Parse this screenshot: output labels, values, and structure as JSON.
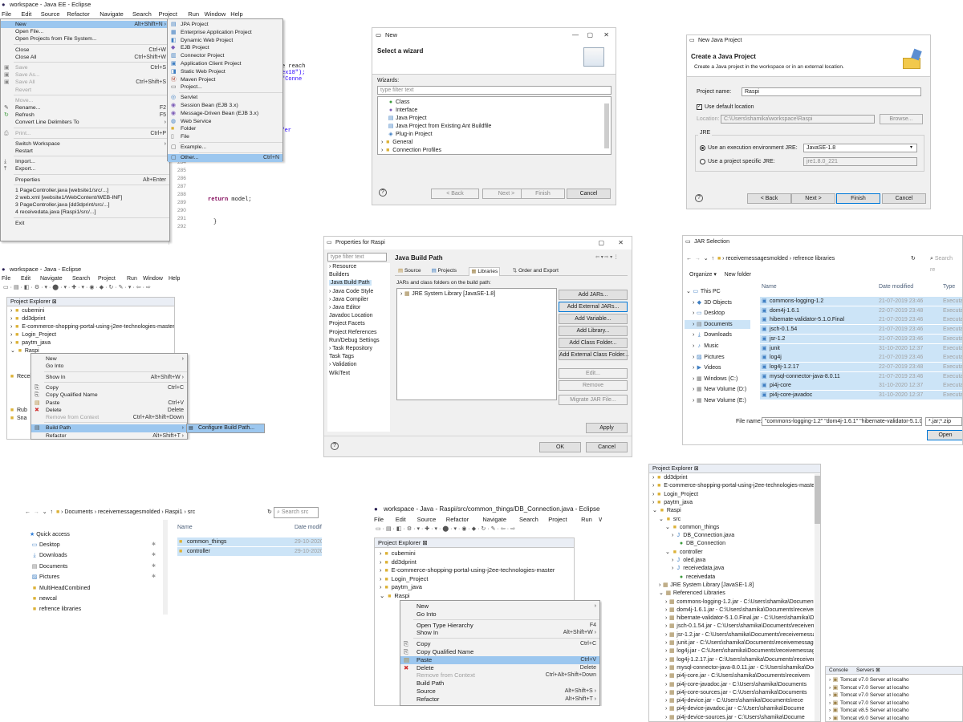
{
  "p1": {
    "title": "workspace - Java EE - Eclipse",
    "menubar": [
      "File",
      "Edit",
      "Source",
      "Refactor",
      "Navigate",
      "Search",
      "Project",
      "Run",
      "Window",
      "Help"
    ],
    "file_menu": [
      {
        "label": "New",
        "shortcut": "Alt+Shift+N ›",
        "state": "hover"
      },
      {
        "label": "Open File..."
      },
      {
        "label": "Open Projects from File System..."
      },
      {
        "sep": true
      },
      {
        "label": "Close",
        "shortcut": "Ctrl+W"
      },
      {
        "label": "Close All",
        "shortcut": "Ctrl+Shift+W"
      },
      {
        "sep": true
      },
      {
        "label": "Save",
        "shortcut": "Ctrl+S",
        "state": "dim"
      },
      {
        "label": "Save As...",
        "state": "dim"
      },
      {
        "label": "Save All",
        "shortcut": "Ctrl+Shift+S",
        "state": "dim"
      },
      {
        "label": "Revert",
        "state": "dim"
      },
      {
        "sep": true
      },
      {
        "label": "Move...",
        "state": "dim"
      },
      {
        "label": "Rename...",
        "shortcut": "F2"
      },
      {
        "label": "Refresh",
        "shortcut": "F5"
      },
      {
        "label": "Convert Line Delimiters To",
        "shortcut": "›"
      },
      {
        "sep": true
      },
      {
        "label": "Print...",
        "shortcut": "Ctrl+P",
        "state": "dim"
      },
      {
        "sep": true
      },
      {
        "label": "Switch Workspace",
        "shortcut": "›"
      },
      {
        "label": "Restart"
      },
      {
        "sep": true
      },
      {
        "label": "Import..."
      },
      {
        "label": "Export..."
      },
      {
        "sep": true
      },
      {
        "label": "Properties",
        "shortcut": "Alt+Enter"
      },
      {
        "sep": true
      },
      {
        "label": "1 PageController.java  [website1/src/...]"
      },
      {
        "label": "2 web.xml  [website1/WebContent/WEB-INF]"
      },
      {
        "label": "3 PageController.java  [dd3dprint/src/...]"
      },
      {
        "label": "4 receivedata.java  [Raspi1/src/...]"
      },
      {
        "sep": true
      },
      {
        "label": "Exit"
      }
    ],
    "new_menu": [
      "JPA Project",
      "Enterprise Application Project",
      "Dynamic Web Project",
      "EJB Project",
      "Connector Project",
      "Application Client Project",
      "Static Web Project",
      "Maven Project",
      "Project...",
      "Servlet",
      "Session Bean (EJB 3.x)",
      "Message-Driven Bean (EJB 3.x)",
      "Web Service",
      "Folder",
      "File",
      "Example...",
      "Other..."
    ],
    "new_other_shortcut": "Ctrl+N",
    "code_frag": [
      "e reach",
      "ex18\");",
      "\"Conne",
      ") {",
      "rintln(\"er",
      "m(ioe.g"
    ],
    "line_numbers": [
      "284",
      "285",
      "286",
      "287",
      "288",
      "289",
      "290",
      "291",
      "292"
    ],
    "code_return": "return model;",
    "brace1": "}",
    "brace2": "}"
  },
  "p2": {
    "title": "New",
    "heading": "Select a wizard",
    "wizards_label": "Wizards:",
    "filter_placeholder": "type filter text",
    "items": [
      "Class",
      "Interface",
      "Java Project",
      "Java Project from Existing Ant Buildfile",
      "Plug-in Project",
      "General",
      "Connection Profiles"
    ],
    "buttons": {
      "back": "< Back",
      "next": "Next >",
      "finish": "Finish",
      "cancel": "Cancel"
    },
    "help": "?"
  },
  "p3": {
    "title": "New Java Project",
    "heading": "Create a Java Project",
    "desc": "Create a Java project in the workspace or in an external location.",
    "project_name_label": "Project name:",
    "project_name": "Raspi",
    "use_default": "Use default location",
    "location_label": "Location:",
    "location": "C:\\Users\\shamika\\workspace\\Raspi",
    "browse": "Browse...",
    "jre_label": "JRE",
    "jre_opt1": "Use an execution environment JRE:",
    "jre_val1": "JavaSE-1.8",
    "jre_opt2": "Use a project specific JRE:",
    "jre_val2": "jre1.8.0_221",
    "buttons": {
      "back": "< Back",
      "next": "Next >",
      "finish": "Finish",
      "cancel": "Cancel"
    },
    "help": "?"
  },
  "p4": {
    "title": "workspace - Java - Eclipse",
    "menubar": [
      "File",
      "Edit",
      "Navigate",
      "Search",
      "Project",
      "Run",
      "Window",
      "Help"
    ],
    "explorer_title": "Project Explorer ⊠",
    "tree": [
      "cubemini",
      "dd3dprint",
      "E-commerce-shopping-portal-using-j2ee-technologies-master",
      "Login_Project",
      "paytm_java",
      "Raspi"
    ],
    "ctx": [
      {
        "label": "New",
        "shortcut": "›"
      },
      {
        "label": "Go Into"
      },
      {
        "sep": true
      },
      {
        "label": "Show In",
        "shortcut": "Alt+Shift+W ›"
      },
      {
        "sep": true
      },
      {
        "label": "Copy",
        "shortcut": "Ctrl+C"
      },
      {
        "label": "Copy Qualified Name"
      },
      {
        "label": "Paste",
        "shortcut": "Ctrl+V"
      },
      {
        "label": "Delete",
        "shortcut": "Delete"
      },
      {
        "label": "Remove from Context",
        "shortcut": "Ctrl+Alt+Shift+Down",
        "state": "dim"
      },
      {
        "sep": true
      },
      {
        "label": "Build Path",
        "shortcut": "›",
        "state": "hover"
      },
      {
        "label": "Refactor",
        "shortcut": "Alt+Shift+T ›"
      }
    ],
    "sub": "Configure Build Path...",
    "peek": [
      "Recei",
      "Rub",
      "Sna"
    ]
  },
  "p5": {
    "title": "Properties for Raspi",
    "filter_placeholder": "type filter text",
    "nav": [
      "Resource",
      "Builders",
      "Java Build Path",
      "Java Code Style",
      "Java Compiler",
      "Java Editor",
      "Javadoc Location",
      "Project Facets",
      "Project References",
      "Run/Debug Settings",
      "Task Repository",
      "Task Tags",
      "Validation",
      "WikiText"
    ],
    "heading": "Java Build Path",
    "tabs": [
      "Source",
      "Projects",
      "Libraries",
      "Order and Export"
    ],
    "jars_label": "JARs and class folders on the build path:",
    "lib": "JRE System Library [JavaSE-1.8]",
    "buttons": [
      "Add JARs...",
      "Add External JARs...",
      "Add Variable...",
      "Add Library...",
      "Add Class Folder...",
      "Add External Class Folder...",
      "Edit...",
      "Remove",
      "Migrate JAR File..."
    ],
    "apply": "Apply",
    "ok": "OK",
    "cancel": "Cancel",
    "help": "?"
  },
  "p6": {
    "title": "JAR Selection",
    "breadcrumb": [
      "receivemessagesmolded",
      "refrence libraries"
    ],
    "search": "Search re",
    "organize": "Organize ▾",
    "new_folder": "New folder",
    "cols": [
      "Name",
      "Date modified",
      "Type"
    ],
    "nav": [
      "This PC",
      "3D Objects",
      "Desktop",
      "Documents",
      "Downloads",
      "Music",
      "Pictures",
      "Videos",
      "Windows (C:)",
      "New Volume (D:)",
      "New Volume (E:)"
    ],
    "files": [
      {
        "n": "commons-logging-1.2",
        "d": "21-07-2019 23:46",
        "t": "Executab"
      },
      {
        "n": "dom4j-1.6.1",
        "d": "22-07-2019 23:48",
        "t": "Executab"
      },
      {
        "n": "hibernate-validator-5.1.0.Final",
        "d": "21-07-2019 23:46",
        "t": "Executab"
      },
      {
        "n": "jsch-0.1.54",
        "d": "21-07-2019 23:46",
        "t": "Executab"
      },
      {
        "n": "jsr-1.2",
        "d": "21-07-2019 23:46",
        "t": "Executab"
      },
      {
        "n": "junit",
        "d": "31-10-2020 12:37",
        "t": "Executab"
      },
      {
        "n": "log4j",
        "d": "21-07-2019 23:46",
        "t": "Executab"
      },
      {
        "n": "log4j-1.2.17",
        "d": "22-07-2019 23:48",
        "t": "Executab"
      },
      {
        "n": "mysql-connector-java-8.0.11",
        "d": "21-07-2019 23:46",
        "t": "Executab"
      },
      {
        "n": "pi4j-core",
        "d": "31-10-2020 12:37",
        "t": "Executab"
      },
      {
        "n": "pi4j-core-javadoc",
        "d": "31-10-2020 12:37",
        "t": "Executab"
      }
    ],
    "filename_label": "File name:",
    "filename": "\"commons-logging-1.2\" \"dom4j-1.6.1\" \"hibernate-validator-5.1.0",
    "filter": "*.jar;*.zip",
    "open": "Open"
  },
  "p7": {
    "breadcrumb": [
      "Documents",
      "receivemessagesmolded",
      "Raspi1",
      "src"
    ],
    "search": "Search src",
    "quick": "Quick access",
    "nav": [
      "Desktop",
      "Downloads",
      "Documents",
      "Pictures",
      "MultiHeadCombined",
      "newcal",
      "refrence libraries"
    ],
    "cols": [
      "Name",
      "Date modif"
    ],
    "files": [
      {
        "n": "common_things",
        "d": "29-10-2020"
      },
      {
        "n": "controller",
        "d": "29-10-2020"
      }
    ]
  },
  "p8": {
    "title": "workspace - Java - Raspi/src/common_things/DB_Connection.java - Eclipse",
    "menubar": [
      "File",
      "Edit",
      "Source",
      "Refactor",
      "Navigate",
      "Search",
      "Project",
      "Run",
      "Window"
    ],
    "explorer_title": "Project Explorer ⊠",
    "tree": [
      "cubemini",
      "dd3dprint",
      "E-commerce-shopping-portal-using-j2ee-technologies-master",
      "Login_Project",
      "paytm_java",
      "Raspi"
    ],
    "ctx": [
      {
        "label": "New",
        "shortcut": "›"
      },
      {
        "label": "Go Into"
      },
      {
        "sep": true
      },
      {
        "label": "Open Type Hierarchy",
        "shortcut": "F4"
      },
      {
        "label": "Show In",
        "shortcut": "Alt+Shift+W ›"
      },
      {
        "sep": true
      },
      {
        "label": "Copy",
        "shortcut": "Ctrl+C"
      },
      {
        "label": "Copy Qualified Name"
      },
      {
        "label": "Paste",
        "shortcut": "Ctrl+V",
        "state": "hover"
      },
      {
        "label": "Delete",
        "shortcut": "Delete"
      },
      {
        "label": "Remove from Context",
        "shortcut": "Ctrl+Alt+Shift+Down",
        "state": "dim"
      },
      {
        "label": "Build Path"
      },
      {
        "label": "Source",
        "shortcut": "Alt+Shift+S ›"
      },
      {
        "label": "Refactor",
        "shortcut": "Alt+Shift+T ›"
      }
    ]
  },
  "p9": {
    "title": "Project Explorer ⊠",
    "tree": [
      {
        "l": "dd3dprint",
        "i": 0,
        "ic": "folder"
      },
      {
        "l": "E-commerce-shopping-portal-using-j2ee-technologies-maste",
        "i": 0,
        "ic": "folder"
      },
      {
        "l": "Login_Project",
        "i": 0,
        "ic": "folder"
      },
      {
        "l": "paytm_java",
        "i": 0,
        "ic": "folder"
      },
      {
        "l": "Raspi",
        "i": 0,
        "ic": "folder",
        "open": true
      },
      {
        "l": "src",
        "i": 1,
        "ic": "folder",
        "open": true
      },
      {
        "l": "common_things",
        "i": 2,
        "ic": "folder",
        "open": true
      },
      {
        "l": "DB_Connection.java",
        "i": 3,
        "ic": "java"
      },
      {
        "l": "DB_Connection",
        "i": 4,
        "ic": "grn"
      },
      {
        "l": "controller",
        "i": 2,
        "ic": "folder",
        "open": true
      },
      {
        "l": "oled.java",
        "i": 3,
        "ic": "java"
      },
      {
        "l": "receivedata.java",
        "i": 3,
        "ic": "java"
      },
      {
        "l": "receivedata",
        "i": 4,
        "ic": "grn"
      },
      {
        "l": "JRE System Library [JavaSE-1.8]",
        "i": 1,
        "ic": "jar"
      },
      {
        "l": "Referenced Libraries",
        "i": 1,
        "ic": "jar",
        "open": true
      },
      {
        "l": "commons-logging-1.2.jar - C:\\Users\\shamika\\Documents\\",
        "i": 2,
        "ic": "jar"
      },
      {
        "l": "dom4j-1.6.1.jar - C:\\Users\\shamika\\Documents\\receiveme",
        "i": 2,
        "ic": "jar"
      },
      {
        "l": "hibernate-validator-5.1.0.Final.jar - C:\\Users\\shamika\\Do",
        "i": 2,
        "ic": "jar"
      },
      {
        "l": "jsch-0.1.54.jar - C:\\Users\\shamika\\Documents\\receiveme",
        "i": 2,
        "ic": "jar"
      },
      {
        "l": "jsr-1.2.jar - C:\\Users\\shamika\\Documents\\receivemessa",
        "i": 2,
        "ic": "jar"
      },
      {
        "l": "junit.jar - C:\\Users\\shamika\\Documents\\receivemessage",
        "i": 2,
        "ic": "jar"
      },
      {
        "l": "log4j.jar - C:\\Users\\shamika\\Documents\\receivemessage",
        "i": 2,
        "ic": "jar"
      },
      {
        "l": "log4j-1.2.17.jar - C:\\Users\\shamika\\Documents\\receivem",
        "i": 2,
        "ic": "jar"
      },
      {
        "l": "mysql-connector-java-8.0.11.jar - C:\\Users\\shamika\\Docu",
        "i": 2,
        "ic": "jar"
      },
      {
        "l": "pi4j-core.jar - C:\\Users\\shamika\\Documents\\receivem",
        "i": 2,
        "ic": "jar"
      },
      {
        "l": "pi4j-core-javadoc.jar - C:\\Users\\shamika\\Documents",
        "i": 2,
        "ic": "jar"
      },
      {
        "l": "pi4j-core-sources.jar - C:\\Users\\shamika\\Documents",
        "i": 2,
        "ic": "jar"
      },
      {
        "l": "pi4j-device.jar - C:\\Users\\shamika\\Documents\\rece",
        "i": 2,
        "ic": "jar"
      },
      {
        "l": "pi4j-device-javadoc.jar - C:\\Users\\shamika\\Docume",
        "i": 2,
        "ic": "jar"
      },
      {
        "l": "pi4j-device-sources.jar - C:\\Users\\shamika\\Docume",
        "i": 2,
        "ic": "jar"
      }
    ],
    "console_tab": "Console",
    "servers_tab": "Servers ⊠",
    "servers": [
      "Tomcat v7.0 Server at localho",
      "Tomcat v7.0 Server at localho",
      "Tomcat v7.0 Server at localho",
      "Tomcat v7.0 Server at localho",
      "Tomcat v8.5 Server at localho",
      "Tomcat v9.0 Server at localho"
    ]
  }
}
